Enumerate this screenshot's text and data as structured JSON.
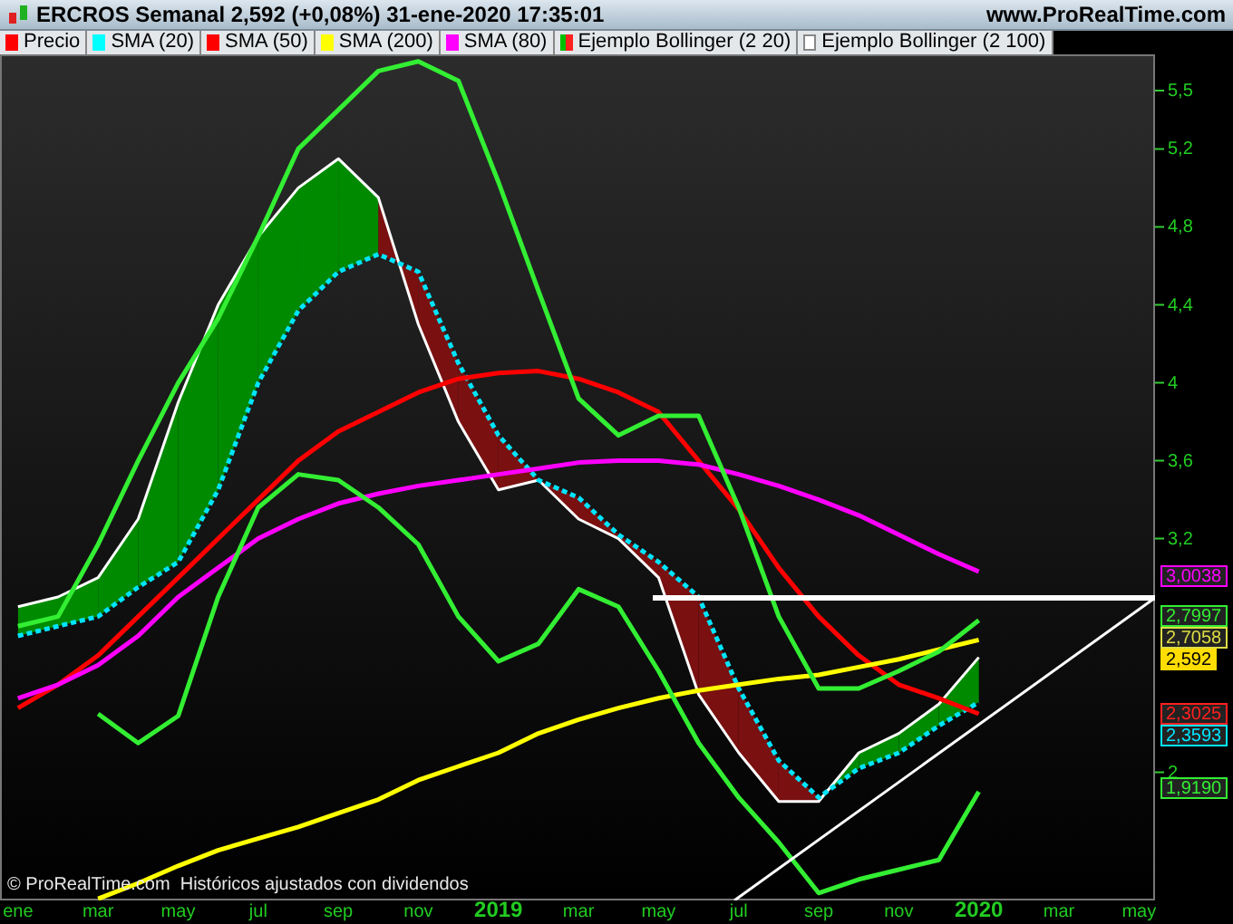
{
  "header": {
    "title": "ERCROS Semanal 2,592 (+0,08%) 31-ene-2020 17:35:01",
    "site": "www.ProRealTime.com"
  },
  "legend_swatches": [
    {
      "kind": "solid",
      "color": "#ff0000"
    },
    {
      "kind": "solid",
      "color": "#00ffff"
    },
    {
      "kind": "solid",
      "color": "#ff0000"
    },
    {
      "kind": "solid",
      "color": "#ffff00"
    },
    {
      "kind": "solid",
      "color": "#ff00ff"
    },
    {
      "kind": "dual",
      "color": "#00c000"
    },
    {
      "kind": "hollow",
      "color": "#ffffff"
    }
  ],
  "chart": {
    "chart_data": {
      "type": "line",
      "categories": [
        "ene",
        null,
        "mar",
        null,
        "may",
        null,
        "jul",
        null,
        "sep",
        null,
        "nov",
        null,
        "2019",
        null,
        "mar",
        null,
        "may",
        null,
        "jul",
        null,
        "sep",
        null,
        "nov",
        null,
        "2020",
        null,
        "mar",
        null,
        "may"
      ],
      "ylim": [
        1.342,
        5.686
      ],
      "yticks": [
        {
          "value": 2,
          "label": "2"
        },
        {
          "value": 3.2,
          "label": "3,2"
        },
        {
          "value": 3.6,
          "label": "3,6"
        },
        {
          "value": 4,
          "label": "4"
        },
        {
          "value": 4.4,
          "label": "4,4"
        },
        {
          "value": 4.8,
          "label": "4,8"
        },
        {
          "value": 5.2,
          "label": "5,2"
        },
        {
          "value": 5.5,
          "label": "5,5"
        }
      ],
      "series": [
        {
          "name": "Precio",
          "color": "#ffffff",
          "values": [
            2.85,
            2.9,
            3.0,
            3.3,
            3.9,
            4.4,
            4.75,
            5.0,
            5.15,
            4.95,
            4.3,
            3.8,
            3.45,
            3.5,
            3.3,
            3.2,
            3.0,
            2.4,
            2.1,
            1.85,
            1.85,
            2.1,
            2.2,
            2.35,
            2.59,
            null,
            null,
            null,
            null
          ]
        },
        {
          "name": "SMA (20)",
          "color": "#00e5ff",
          "line_style": "dashed",
          "values": [
            2.7,
            2.75,
            2.8,
            2.95,
            3.08,
            3.45,
            4.0,
            4.37,
            4.57,
            4.66,
            4.57,
            4.1,
            3.73,
            3.5,
            3.41,
            3.22,
            3.08,
            2.9,
            2.43,
            2.06,
            1.87,
            2.02,
            2.1,
            2.24,
            2.36,
            null,
            null,
            null,
            null
          ]
        },
        {
          "name": "SMA (50)",
          "color": "#ff0000",
          "values": [
            2.33,
            2.45,
            2.6,
            2.8,
            3.0,
            3.2,
            3.4,
            3.6,
            3.75,
            3.85,
            3.95,
            4.02,
            4.05,
            4.06,
            4.02,
            3.95,
            3.85,
            3.6,
            3.35,
            3.05,
            2.8,
            2.6,
            2.45,
            2.38,
            2.3,
            null,
            null,
            null,
            null
          ]
        },
        {
          "name": "SMA (200)",
          "color": "#ffff00",
          "values": [
            null,
            null,
            1.35,
            1.43,
            1.52,
            1.6,
            1.66,
            1.72,
            1.79,
            1.86,
            1.96,
            2.03,
            2.1,
            2.2,
            2.27,
            2.33,
            2.38,
            2.42,
            2.45,
            2.48,
            2.5,
            2.54,
            2.58,
            2.63,
            2.68,
            null,
            null,
            null,
            null
          ]
        },
        {
          "name": "SMA (80)",
          "color": "#ff00ff",
          "values": [
            2.38,
            2.45,
            2.55,
            2.7,
            2.9,
            3.05,
            3.2,
            3.3,
            3.38,
            3.43,
            3.47,
            3.5,
            3.53,
            3.56,
            3.59,
            3.6,
            3.6,
            3.58,
            3.53,
            3.47,
            3.4,
            3.32,
            3.22,
            3.12,
            3.03,
            null,
            null,
            null,
            null
          ]
        },
        {
          "name": "Ejemplo Bollinger (2 20)",
          "color": "#33ee33",
          "values": [
            2.75,
            2.8,
            3.17,
            3.6,
            4.0,
            4.33,
            4.75,
            5.2,
            5.4,
            5.6,
            5.65,
            5.55,
            5.03,
            4.47,
            3.92,
            3.73,
            3.83,
            3.83,
            3.36,
            2.8,
            2.43,
            2.43,
            2.52,
            2.62,
            2.78,
            null,
            null,
            null,
            null
          ]
        },
        {
          "name": "Ejemplo Bollinger (2 100)",
          "color": "#33ee33",
          "values": [
            null,
            null,
            2.3,
            2.15,
            2.29,
            2.9,
            3.36,
            3.53,
            3.5,
            3.36,
            3.17,
            2.8,
            2.57,
            2.66,
            2.94,
            2.85,
            2.52,
            2.15,
            1.87,
            1.64,
            1.38,
            1.45,
            1.5,
            1.55,
            1.9,
            null,
            null,
            null,
            null
          ]
        }
      ]
    },
    "price_labels": [
      {
        "text": "3,0038",
        "kind": "outlined",
        "color": "#ff00ff"
      },
      {
        "text": "2,7997",
        "kind": "outlined",
        "color": "#33ee33"
      },
      {
        "text": "2,7058",
        "kind": "outlined",
        "color": "#dddd44"
      },
      {
        "text": "2,592",
        "kind": "filled",
        "color": "#ffdd00"
      },
      {
        "text": "2,3025",
        "kind": "outlined",
        "color": "#ff2020"
      },
      {
        "text": "2,3593",
        "kind": "outlined",
        "color": "#00e5ff"
      },
      {
        "text": "1,9190",
        "kind": "outlined",
        "color": "#33ee33"
      }
    ],
    "footnote": "© ProRealTime.com  Históricos ajustados con dividendos"
  }
}
